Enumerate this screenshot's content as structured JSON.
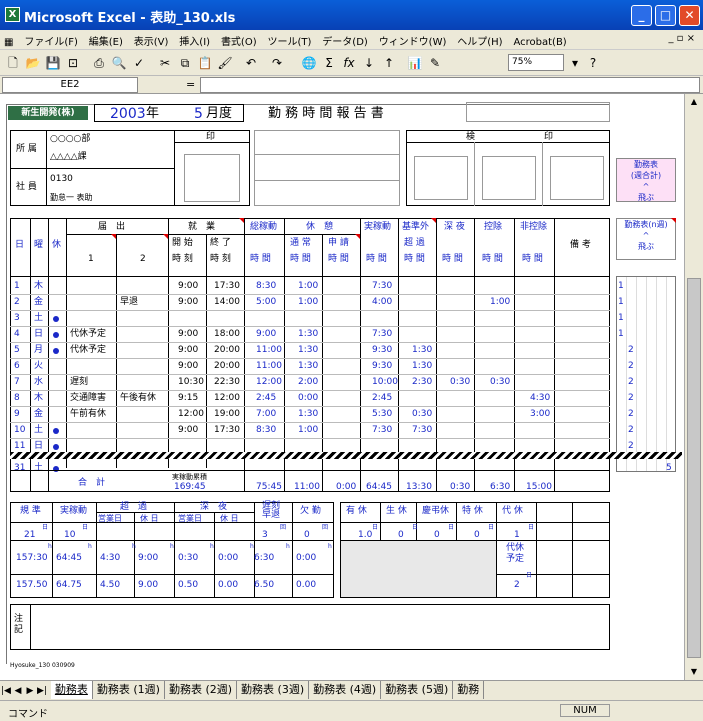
{
  "window": {
    "title": "Microsoft Excel - 表助_130.xls",
    "minimize": "_",
    "maximize": "□",
    "close": "✕"
  },
  "menu": [
    "ファイル(F)",
    "編集(E)",
    "表示(V)",
    "挿入(I)",
    "書式(O)",
    "ツール(T)",
    "データ(D)",
    "ウィンドウ(W)",
    "ヘルプ(H)",
    "Acrobat(B)"
  ],
  "doc_controls": "_ ▫ ×",
  "toolbar": {
    "zoom": "75%",
    "help": "?"
  },
  "formula_bar": {
    "name_box": "EE2",
    "fx": "=",
    "value": ""
  },
  "header": {
    "company": "新生開発(株)",
    "year": "2003",
    "year_unit": "年",
    "month": "5",
    "month_unit": "月度",
    "title": "勤 務 時 間 報 告 書"
  },
  "info": {
    "dept_label": "所 属",
    "dept1": "○○○○部",
    "dept2": "△△△△課",
    "emp_label": "社 員",
    "emp_id": "0130",
    "emp_name": "勤怠一 表助",
    "seal": "印",
    "approval": "検",
    "approval_seal": "印"
  },
  "buttons": {
    "weekly_total": "勤務表\n(週合計)\n^\n飛ぶ",
    "week_n": "勤務表(n週)\n^\n飛ぶ"
  },
  "table_head": {
    "day": "日",
    "dow": "曜",
    "holiday": "休",
    "attend": "届　出",
    "att1": "1",
    "att2": "2",
    "work": "就　業",
    "start": "開 始",
    "end": "終 了",
    "time_a": "時 刻",
    "time_b": "時 刻",
    "total": "総稼動",
    "rest": "休　憩",
    "normal": "通 常",
    "request": "申 請",
    "actual": "実稼動",
    "over": "基準外",
    "over2": "超 過",
    "night": "深 夜",
    "deduct": "控除",
    "nondeduct": "非控除",
    "note": "備 考",
    "hours": "時 間"
  },
  "rows": [
    {
      "d": "1",
      "w": "木",
      "h": "",
      "a1": "",
      "a2": "",
      "s": "9:00",
      "e": "17:30",
      "t": "8:30",
      "r": "1:00",
      "q": "",
      "ac": "7:30",
      "ov": "",
      "n": "",
      "dc": "",
      "nd": "",
      "wk": "1"
    },
    {
      "d": "2",
      "w": "金",
      "h": "",
      "a1": "",
      "a2": "早退",
      "s": "9:00",
      "e": "14:00",
      "t": "5:00",
      "r": "1:00",
      "q": "",
      "ac": "4:00",
      "ov": "",
      "n": "",
      "dc": "1:00",
      "nd": "",
      "wk": "1"
    },
    {
      "d": "3",
      "w": "土",
      "h": "●",
      "a1": "",
      "a2": "",
      "s": "",
      "e": "",
      "t": "",
      "r": "",
      "q": "",
      "ac": "",
      "ov": "",
      "n": "",
      "dc": "",
      "nd": "",
      "wk": "1"
    },
    {
      "d": "4",
      "w": "日",
      "h": "●",
      "a1": "代休予定",
      "a2": "",
      "s": "9:00",
      "e": "18:00",
      "t": "9:00",
      "r": "1:30",
      "q": "",
      "ac": "7:30",
      "ov": "",
      "n": "",
      "dc": "",
      "nd": "",
      "wk": "1"
    },
    {
      "d": "5",
      "w": "月",
      "h": "●",
      "a1": "代休予定",
      "a2": "",
      "s": "9:00",
      "e": "20:00",
      "t": "11:00",
      "r": "1:30",
      "q": "",
      "ac": "9:30",
      "ov": "1:30",
      "n": "",
      "dc": "",
      "nd": "",
      "wk": "2"
    },
    {
      "d": "6",
      "w": "火",
      "h": "",
      "a1": "",
      "a2": "",
      "s": "9:00",
      "e": "20:00",
      "t": "11:00",
      "r": "1:30",
      "q": "",
      "ac": "9:30",
      "ov": "1:30",
      "n": "",
      "dc": "",
      "nd": "",
      "wk": "2"
    },
    {
      "d": "7",
      "w": "水",
      "h": "",
      "a1": "遅刻",
      "a2": "",
      "s": "10:30",
      "e": "22:30",
      "t": "12:00",
      "r": "2:00",
      "q": "",
      "ac": "10:00",
      "ov": "2:30",
      "n": "0:30",
      "dc": "0:30",
      "nd": "",
      "wk": "2"
    },
    {
      "d": "8",
      "w": "木",
      "h": "",
      "a1": "交通障害",
      "a2": "午後有休",
      "s": "9:15",
      "e": "12:00",
      "t": "2:45",
      "r": "0:00",
      "q": "",
      "ac": "2:45",
      "ov": "",
      "n": "",
      "dc": "",
      "nd": "4:30",
      "wk": "2"
    },
    {
      "d": "9",
      "w": "金",
      "h": "",
      "a1": "午前有休",
      "a2": "",
      "s": "12:00",
      "e": "19:00",
      "t": "7:00",
      "r": "1:30",
      "q": "",
      "ac": "5:30",
      "ov": "0:30",
      "n": "",
      "dc": "",
      "nd": "3:00",
      "wk": "2"
    },
    {
      "d": "10",
      "w": "土",
      "h": "●",
      "a1": "",
      "a2": "",
      "s": "9:00",
      "e": "17:30",
      "t": "8:30",
      "r": "1:00",
      "q": "",
      "ac": "7:30",
      "ov": "7:30",
      "n": "",
      "dc": "",
      "nd": "",
      "wk": "2"
    },
    {
      "d": "11",
      "w": "日",
      "h": "●",
      "a1": "",
      "a2": "",
      "s": "",
      "e": "",
      "t": "",
      "r": "",
      "q": "",
      "ac": "",
      "ov": "",
      "n": "",
      "dc": "",
      "nd": "",
      "wk": "2"
    },
    {
      "d": "31",
      "w": "土",
      "h": "●",
      "a1": "",
      "a2": "",
      "s": "",
      "e": "",
      "t": "",
      "r": "",
      "q": "",
      "ac": "",
      "ov": "",
      "n": "",
      "dc": "",
      "nd": "",
      "wk": "5"
    }
  ],
  "totals": {
    "label": "合　計",
    "cum_label": "実稼動累積",
    "cum": "169:45",
    "total": "75:45",
    "normal": "11:00",
    "request": "0:00",
    "actual": "64:45",
    "over": "13:30",
    "night": "0:30",
    "deduct": "6:30",
    "nondeduct": "15:00"
  },
  "summary": {
    "heads": [
      "規 準",
      "実稼動",
      "超　過",
      "深　夜",
      "遅刻\n早退",
      "欠 勤"
    ],
    "subheads": [
      "営業日",
      "休 日",
      "営業日",
      "休 日"
    ],
    "unit_day": "日",
    "unit_h": "h",
    "unit_count": "回",
    "days": [
      "21",
      "10",
      "",
      "",
      "",
      "",
      "3",
      "0"
    ],
    "hours": [
      "157:30",
      "64:45",
      "4:30",
      "9:00",
      "0:30",
      "0:00",
      "6:30",
      "0:00"
    ],
    "decimal": [
      "157.50",
      "64.75",
      "4.50",
      "9.00",
      "0.50",
      "0.00",
      "6.50",
      "0.00"
    ]
  },
  "leave": {
    "heads": [
      "有 休",
      "生 休",
      "慶弔休",
      "特 休",
      "代 休"
    ],
    "unit": "日",
    "values": [
      "1.0",
      "0",
      "0",
      "0",
      "1"
    ],
    "dai_label": "代休\n予定",
    "dai_value": "2"
  },
  "remarks_label": "注\n記",
  "footer_code": "Hyosuke_130 030909",
  "tabs": [
    "勤務表",
    "勤務表 (1週)",
    "勤務表 (2週)",
    "勤務表 (3週)",
    "勤務表 (4週)",
    "勤務表 (5週)",
    "勤務"
  ],
  "status": {
    "mode": "コマンド",
    "num": "NUM"
  }
}
